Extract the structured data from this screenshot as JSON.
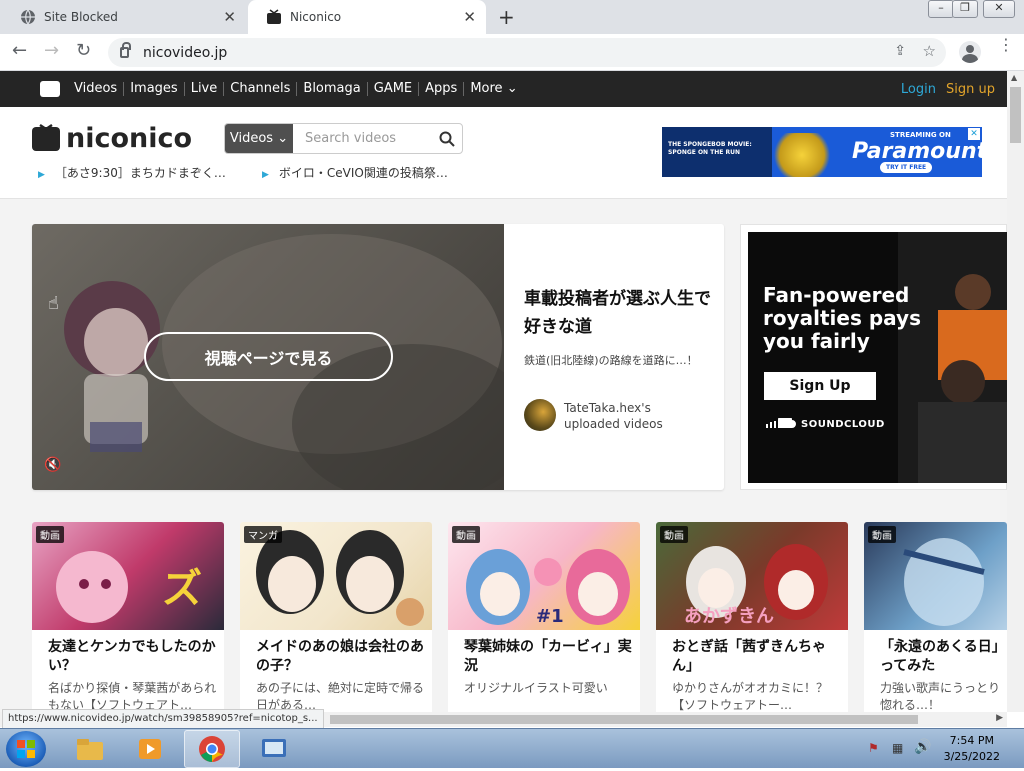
{
  "browser": {
    "tabs": [
      {
        "title": "Site Blocked",
        "icon": "globe-icon"
      },
      {
        "title": "Niconico",
        "icon": "niconico-tv-icon"
      }
    ],
    "url": "nicovideo.jp",
    "status_url": "https://www.nicovideo.jp/watch/sm39858905?ref=nicotop_s..."
  },
  "nav": {
    "items": [
      "Videos",
      "Images",
      "Live",
      "Channels",
      "Blomaga",
      "GAME",
      "Apps",
      "More"
    ],
    "login": "Login",
    "signup": "Sign up"
  },
  "header": {
    "logo": "niconico",
    "search_select": "Videos",
    "search_placeholder": "Search videos",
    "tickers": [
      "［あさ9:30］まちカドまぞく…",
      "ボイロ・CeVIO関連の投稿祭…"
    ]
  },
  "top_ad": {
    "left_text": "THE SPONGEBOB MOVIE: SPONGE ON THE RUN",
    "streaming": "STREAMING ON",
    "brand": "Paramount+",
    "cta": "TRY IT FREE"
  },
  "hero": {
    "button": "視聴ページで見る",
    "title": "車載投稿者が選ぶ人生で好きな道",
    "description": "鉄道(旧北陸線)の路線を道路に…！",
    "user": "TateTaka.hex's uploaded videos"
  },
  "side_ad": {
    "headline": "Fan-powered royalties pays you fairly",
    "button": "Sign Up",
    "brand": "SOUNDCLOUD"
  },
  "cards": [
    {
      "tag": "動画",
      "title": "友達とケンカでもしたのかい？",
      "sub": "名ばかり探偵・琴葉茜があられもない【ソフトウェアト…",
      "color": "#c03a6a"
    },
    {
      "tag": "マンガ",
      "title": "メイドのあの娘は会社のあの子？",
      "sub": "あの子には、絶対に定時で帰る日がある…",
      "color": "#f2e6cc"
    },
    {
      "tag": "動画",
      "title": "琴葉姉妹の「カービィ」実況",
      "sub": "オリジナルイラスト可愛い",
      "color": "#f7b6c8"
    },
    {
      "tag": "動画",
      "title": "おとぎ話「茜ずきんちゃん」",
      "sub": "ゆかりさんがオオカミに！？【ソフトウェアトー…",
      "color": "#7a3a2a"
    },
    {
      "tag": "動画",
      "title": "「永遠のあくる日」ってみた",
      "sub": "力強い歌声にうっとり惚れる…！",
      "color": "#6ea0c8"
    }
  ],
  "taskbar": {
    "time": "7:54 PM",
    "date": "3/25/2022"
  }
}
